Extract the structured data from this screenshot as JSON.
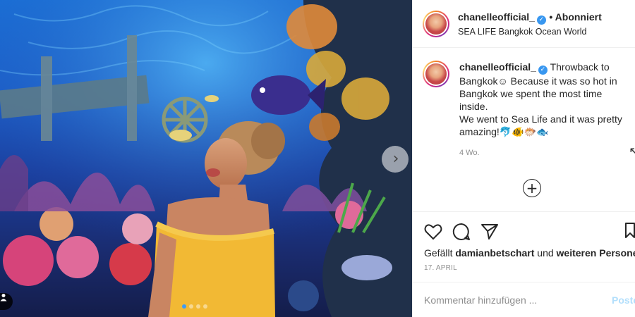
{
  "post": {
    "image_alt": "photo",
    "carousel": {
      "next_icon": "chevron-right-icon",
      "dots_total": 4,
      "active_dot": 1
    }
  },
  "header": {
    "username": "chanelleofficial_",
    "verified_icon": "verified-badge-icon",
    "follow_state": "• Abonniert",
    "location": "SEA LIFE Bangkok Ocean World"
  },
  "caption": {
    "username": "chanelleofficial_",
    "text_line1": "Throwback to Bangkok☺ Because it was so hot in Bangkok we spent the most time inside.",
    "text_line2": "We went to Sea Life and it was pretty amazing!🐬🐠🐡🐟",
    "time_ago": "4 Wo."
  },
  "load_more_icon": "plus-circle-icon",
  "actions": {
    "like_icon": "heart-icon",
    "comment_icon": "comment-icon",
    "share_icon": "share-icon",
    "save_icon": "bookmark-icon"
  },
  "likes": {
    "prefix": "Gefällt ",
    "user": "damianbetschart",
    "middle": " und ",
    "others": "weiteren Personen"
  },
  "date": "17. APRIL",
  "comment_box": {
    "placeholder": "Kommentar hinzufügen ...",
    "post_label": "Posten"
  },
  "colors": {
    "accent": "#3897f0",
    "post_disabled": "#b2dffc",
    "muted": "#8e8e8e"
  }
}
